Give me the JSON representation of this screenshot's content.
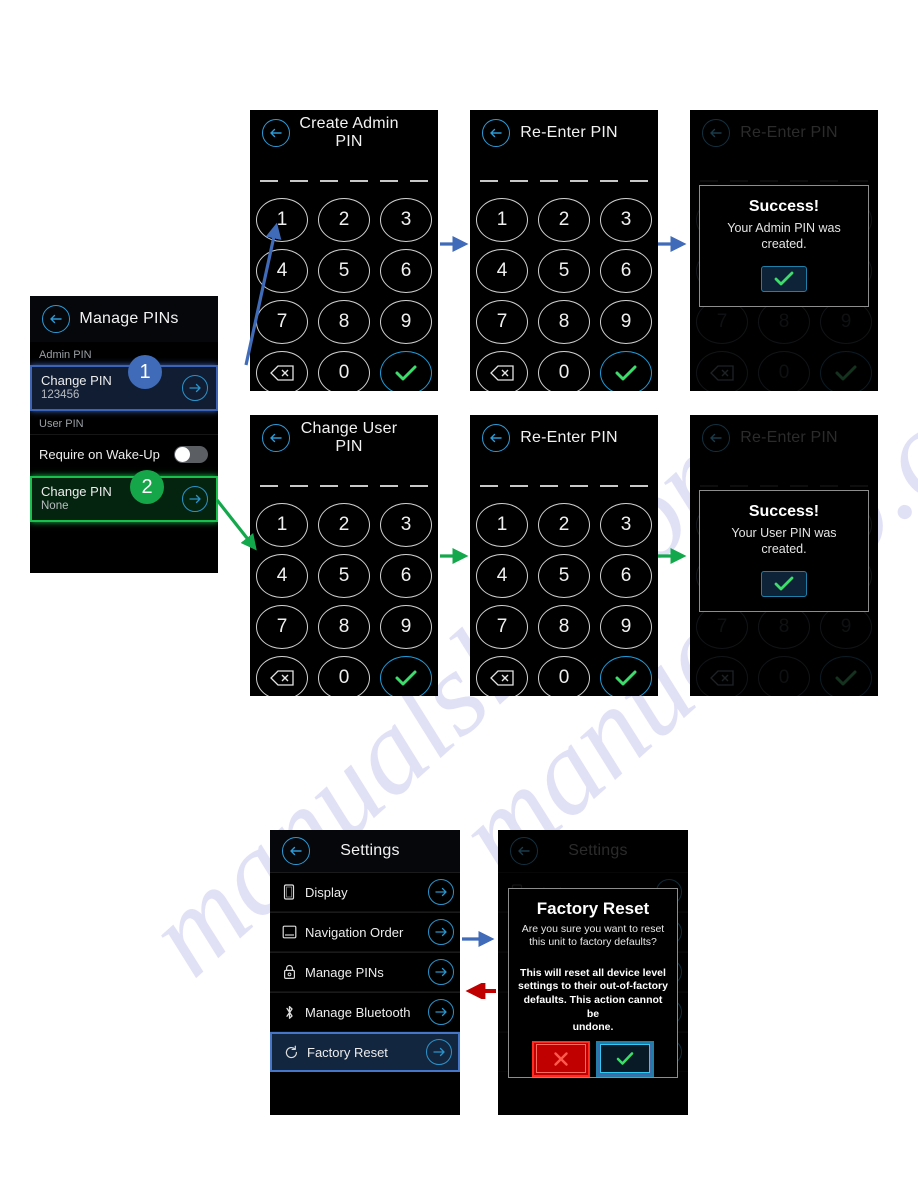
{
  "watermark": {
    "line1": "manualslib.com",
    "line2": "manualslib.com"
  },
  "manage_pins": {
    "title": "Manage PINs",
    "section_admin": "Admin PIN",
    "section_user": "User PIN",
    "admin_change_label": "Change PIN",
    "admin_change_value": "123456",
    "require_wake_label": "Require on Wake-Up",
    "user_change_label": "Change PIN",
    "user_change_value": "None",
    "badge_1": "1",
    "badge_2": "2",
    "toggle_state": "off",
    "highlight_admin_color": "#3c63b5",
    "highlight_user_color": "#19c04e"
  },
  "keypad": {
    "keys": [
      "1",
      "2",
      "3",
      "4",
      "5",
      "6",
      "7",
      "8",
      "9"
    ],
    "backspace_label": "backspace",
    "zero": "0",
    "confirm_label": "confirm",
    "dash_count": 6
  },
  "screens": {
    "create_admin_pin": {
      "title": "Create Admin PIN"
    },
    "reenter_pin_admin": {
      "title": "Re-Enter PIN"
    },
    "success_admin": {
      "bg_title": "Re-Enter PIN",
      "title": "Success!",
      "line1": "Your Admin PIN was",
      "line2": "created."
    },
    "change_user_pin": {
      "title": "Change  User  PIN"
    },
    "reenter_pin_user": {
      "title": "Re-Enter PIN"
    },
    "success_user": {
      "bg_title": "Re-Enter PIN",
      "title": "Success!",
      "line1": "Your  User  PIN was",
      "line2": "created."
    },
    "settings": {
      "title": "Settings",
      "items": [
        {
          "label": "Display",
          "icon": "display-icon",
          "selected": false
        },
        {
          "label": "Navigation Order",
          "icon": "navigation-order-icon",
          "selected": false
        },
        {
          "label": "Manage PINs",
          "icon": "lock-icon",
          "selected": false
        },
        {
          "label": "Manage Bluetooth",
          "icon": "bluetooth-icon",
          "selected": false
        },
        {
          "label": "Factory Reset",
          "icon": "reset-icon",
          "selected": true
        }
      ]
    },
    "factory_reset": {
      "bg_title": "Settings",
      "title": "Factory Reset",
      "question_line1": "Are you sure you want to reset",
      "question_line2": "this unit to factory defaults?",
      "body_line1": "This will reset all device level",
      "body_line2": "settings to their out-of-factory",
      "body_line3": "defaults. This action cannot be",
      "body_line4": "undone.",
      "cancel_label": "cancel",
      "confirm_label": "confirm"
    }
  },
  "flow_arrows": {
    "admin_color": "#3f6bb8",
    "user_color": "#14a84c",
    "back_color": "#c00000"
  }
}
